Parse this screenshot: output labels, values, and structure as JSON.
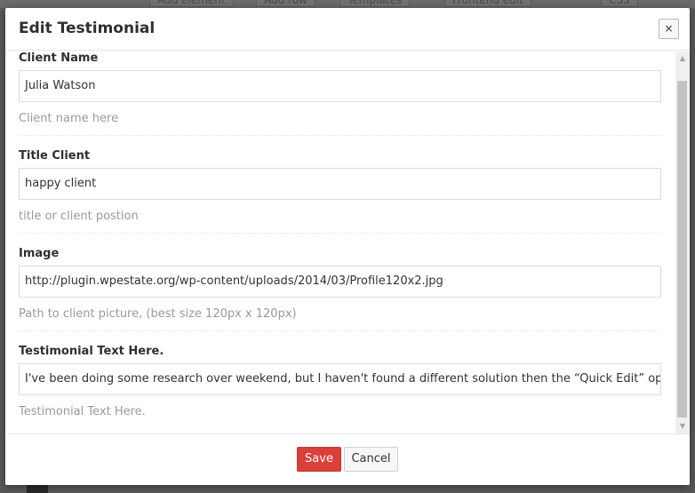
{
  "background": {
    "toolbar_items": [
      "Add element",
      "Add row",
      "Templates",
      "Frontend edit",
      "CSS"
    ]
  },
  "dialog": {
    "title": "Edit Testimonial",
    "close_label": "×"
  },
  "fields": [
    {
      "label": "Client Name",
      "value": "Julia Watson",
      "description": "Client name here"
    },
    {
      "label": "Title Client",
      "value": "happy client",
      "description": "title or client postion"
    },
    {
      "label": "Image",
      "value": "http://plugin.wpestate.org/wp-content/uploads/2014/03/Profile120x2.jpg",
      "description": "Path to client picture, (best size 120px x 120px)"
    },
    {
      "label": "Testimonial Text Here.",
      "value": "I've been doing some research over weekend, but I haven't found a different solution then the “Quick Edit” option in Prc",
      "description": "Testimonial Text Here."
    }
  ],
  "footer": {
    "save_label": "Save",
    "cancel_label": "Cancel"
  },
  "colors": {
    "save_button": "#d9403a",
    "overlay": "#5a5a5a"
  }
}
